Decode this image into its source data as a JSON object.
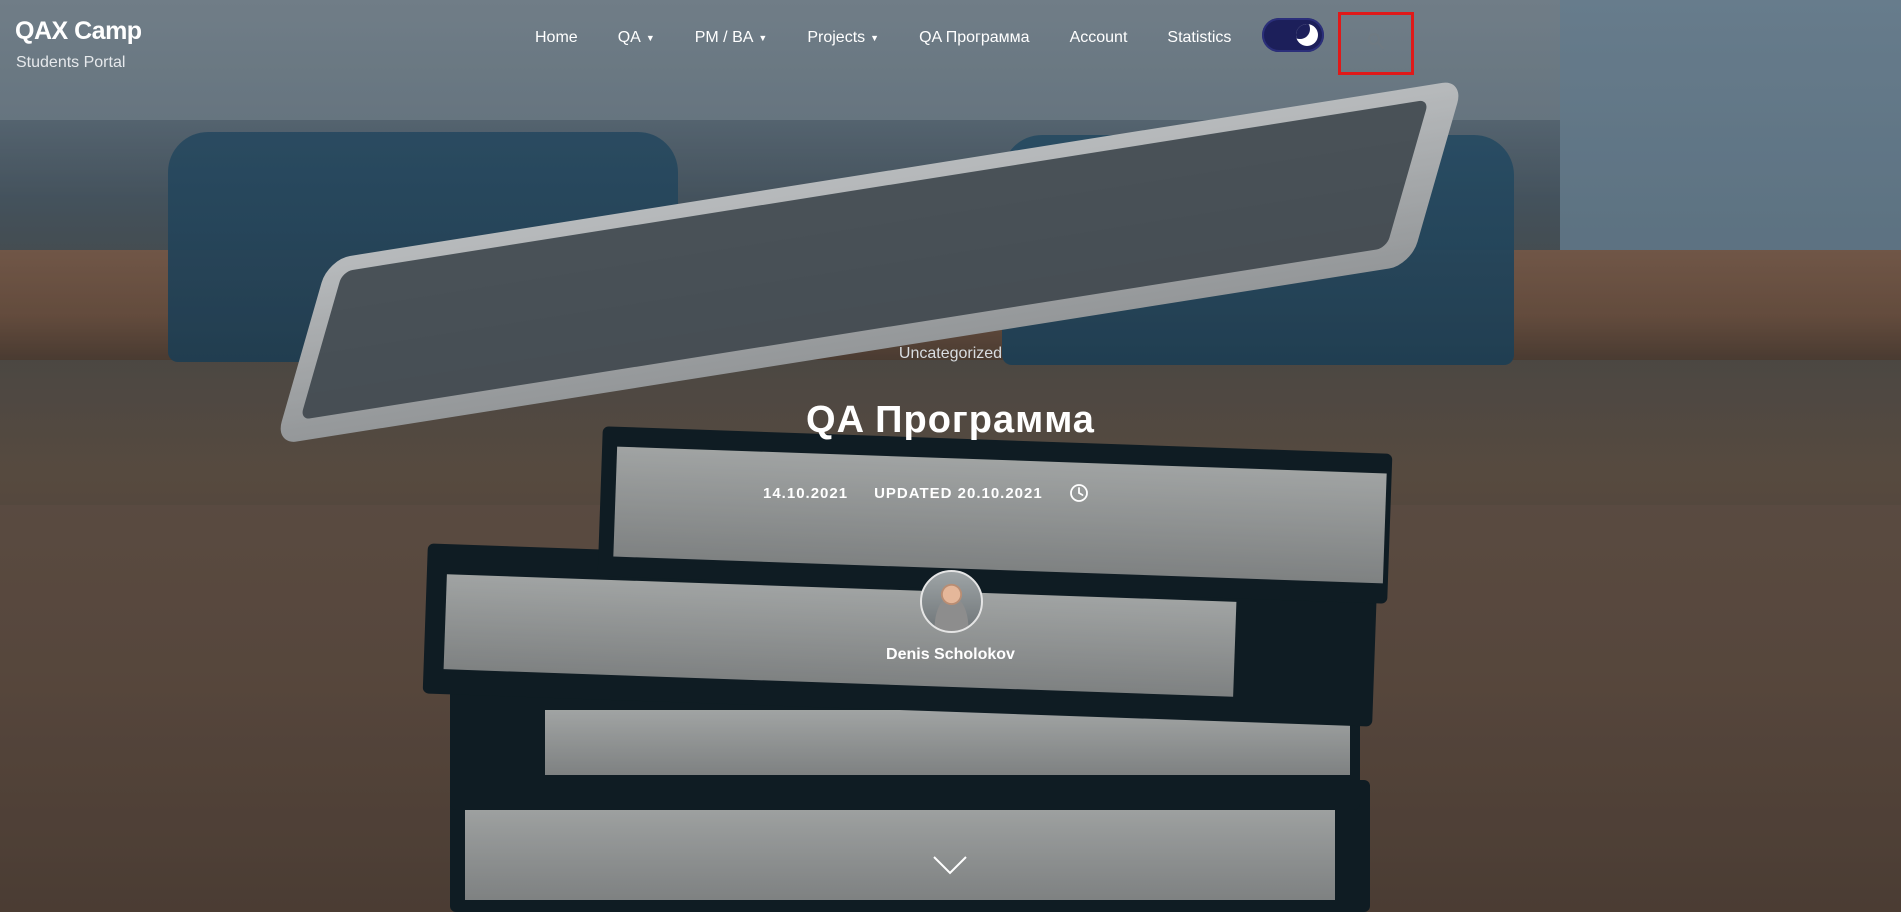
{
  "site": {
    "title": "QAX Camp",
    "tagline": "Students Portal"
  },
  "nav": {
    "items": [
      {
        "label": "Home",
        "has_dropdown": false
      },
      {
        "label": "QA",
        "has_dropdown": true
      },
      {
        "label": "PM / BA",
        "has_dropdown": true
      },
      {
        "label": "Projects",
        "has_dropdown": true
      },
      {
        "label": "QA Программа",
        "has_dropdown": false
      },
      {
        "label": "Account",
        "has_dropdown": false
      },
      {
        "label": "Statistics",
        "has_dropdown": false
      }
    ],
    "caret_glyph": "▼",
    "dark_mode_toggle": {
      "state": "on",
      "icon": "moon-icon",
      "color": "#1c1f5a"
    },
    "search": {
      "icon": "search-icon",
      "highlight_color": "#e01919"
    }
  },
  "post": {
    "category": "Uncategorized",
    "title": "QA Программа",
    "date": "14.10.2021",
    "updated": "UPDATED 20.10.2021",
    "clock_icon": "clock-icon",
    "author": {
      "name": "Denis Scholokov",
      "avatar_icon": "author-avatar"
    }
  },
  "scroll_indicator": {
    "icon": "chevron-down-icon"
  }
}
